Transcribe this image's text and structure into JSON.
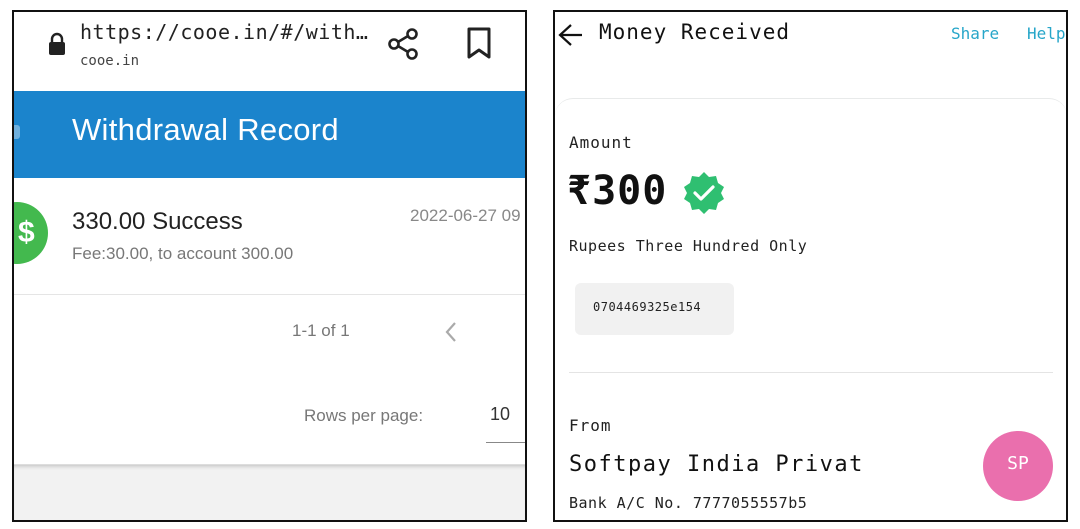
{
  "left_screen": {
    "browser": {
      "url": "https://cooe.in/#/with…",
      "domain": "cooe.in",
      "lock_icon": "lock-icon",
      "share_icon": "share-icon",
      "bookmark_icon": "bookmark-icon"
    },
    "header": {
      "title": "Withdrawal Record",
      "background": "#1b84cc"
    },
    "records": [
      {
        "amount_status": "330.00 Success",
        "fee_line": "Fee:30.00, to account 300.00",
        "date": "2022-06-27 09",
        "icon": "dollar-icon",
        "icon_color": "#43b94e"
      }
    ],
    "pagination": {
      "range": "1-1 of 1",
      "rows_label": "Rows per page:",
      "rows_value": "10"
    }
  },
  "right_screen": {
    "topbar": {
      "title": "Money Received",
      "share": "Share",
      "help": "Help"
    },
    "amount": {
      "label": "Amount",
      "value": "₹300",
      "words": "Rupees Three Hundred Only",
      "verified_icon": "check-badge-icon",
      "verified_color": "#2fbf71"
    },
    "transaction_id": "0704469325e154",
    "from": {
      "label": "From",
      "name": "Softpay India Privat",
      "bank_account": "Bank A/C No. 7777055557b5"
    },
    "avatar": {
      "initials": "SP",
      "color": "#ea6fad"
    }
  }
}
